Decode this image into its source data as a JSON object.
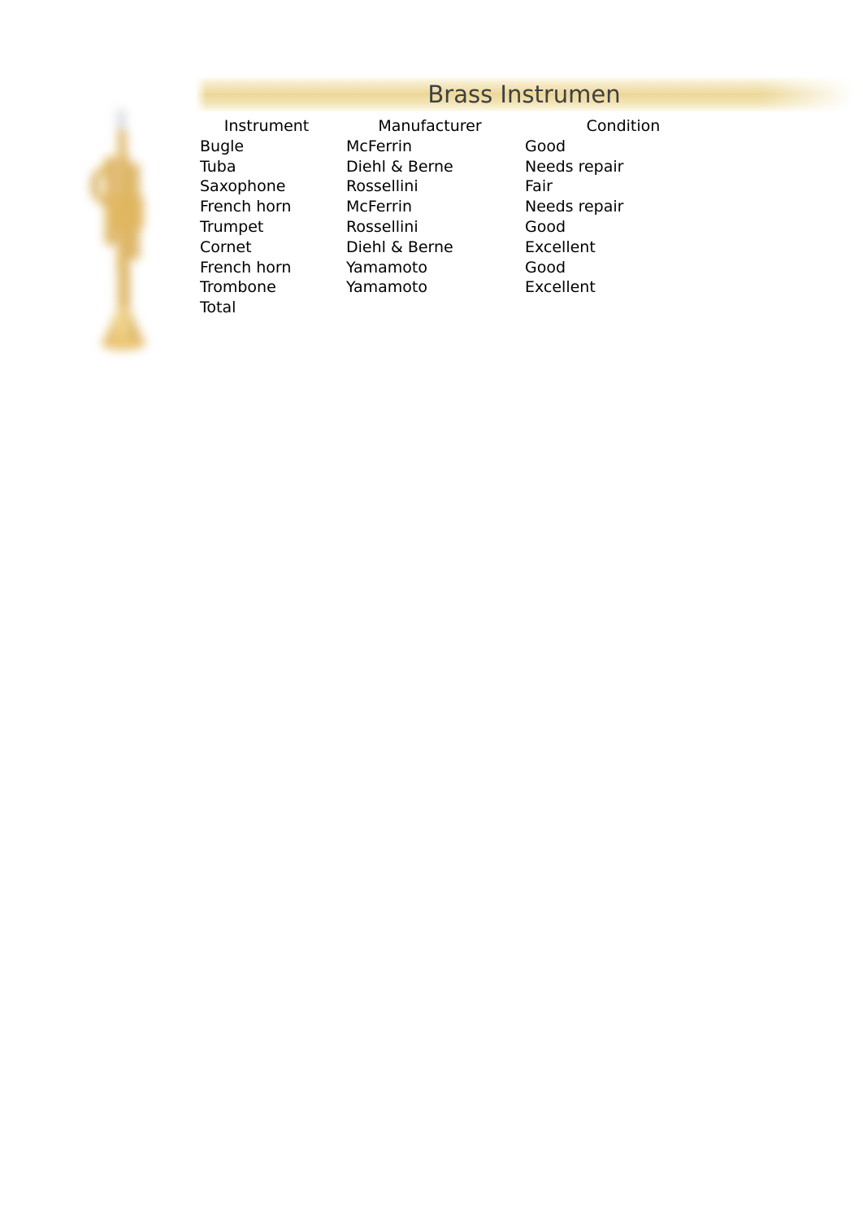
{
  "document": {
    "title": "Brass Instrumen"
  },
  "artwork": {
    "name": "trumpet-illustration",
    "brass_color": "#d9a23a",
    "brass_light": "#f0cd74",
    "brass_dark": "#c08a24",
    "mouthpiece_color": "#c9c9d2"
  },
  "theme": {
    "banner_mid": "#ecd898",
    "banner_edge": "#fdfaf0",
    "title_text": "#3f4044",
    "body_text": "#000000",
    "page_background": "#ffffff"
  },
  "table": {
    "headers": [
      "Instrument",
      "Manufacturer",
      "Condition"
    ],
    "rows": [
      {
        "instrument": "Bugle",
        "manufacturer": "McFerrin",
        "condition": "Good"
      },
      {
        "instrument": "Tuba",
        "manufacturer": "Diehl & Berne",
        "condition": "Needs repair"
      },
      {
        "instrument": "Saxophone",
        "manufacturer": "Rossellini",
        "condition": "Fair"
      },
      {
        "instrument": "French horn",
        "manufacturer": "McFerrin",
        "condition": "Needs repair"
      },
      {
        "instrument": "Trumpet",
        "manufacturer": "Rossellini",
        "condition": "Good"
      },
      {
        "instrument": "Cornet",
        "manufacturer": "Diehl & Berne",
        "condition": "Excellent"
      },
      {
        "instrument": "French horn",
        "manufacturer": "Yamamoto",
        "condition": "Good"
      },
      {
        "instrument": "Trombone",
        "manufacturer": "Yamamoto",
        "condition": "Excellent"
      }
    ],
    "total_row": {
      "instrument": "Total",
      "manufacturer": "",
      "condition": ""
    }
  }
}
